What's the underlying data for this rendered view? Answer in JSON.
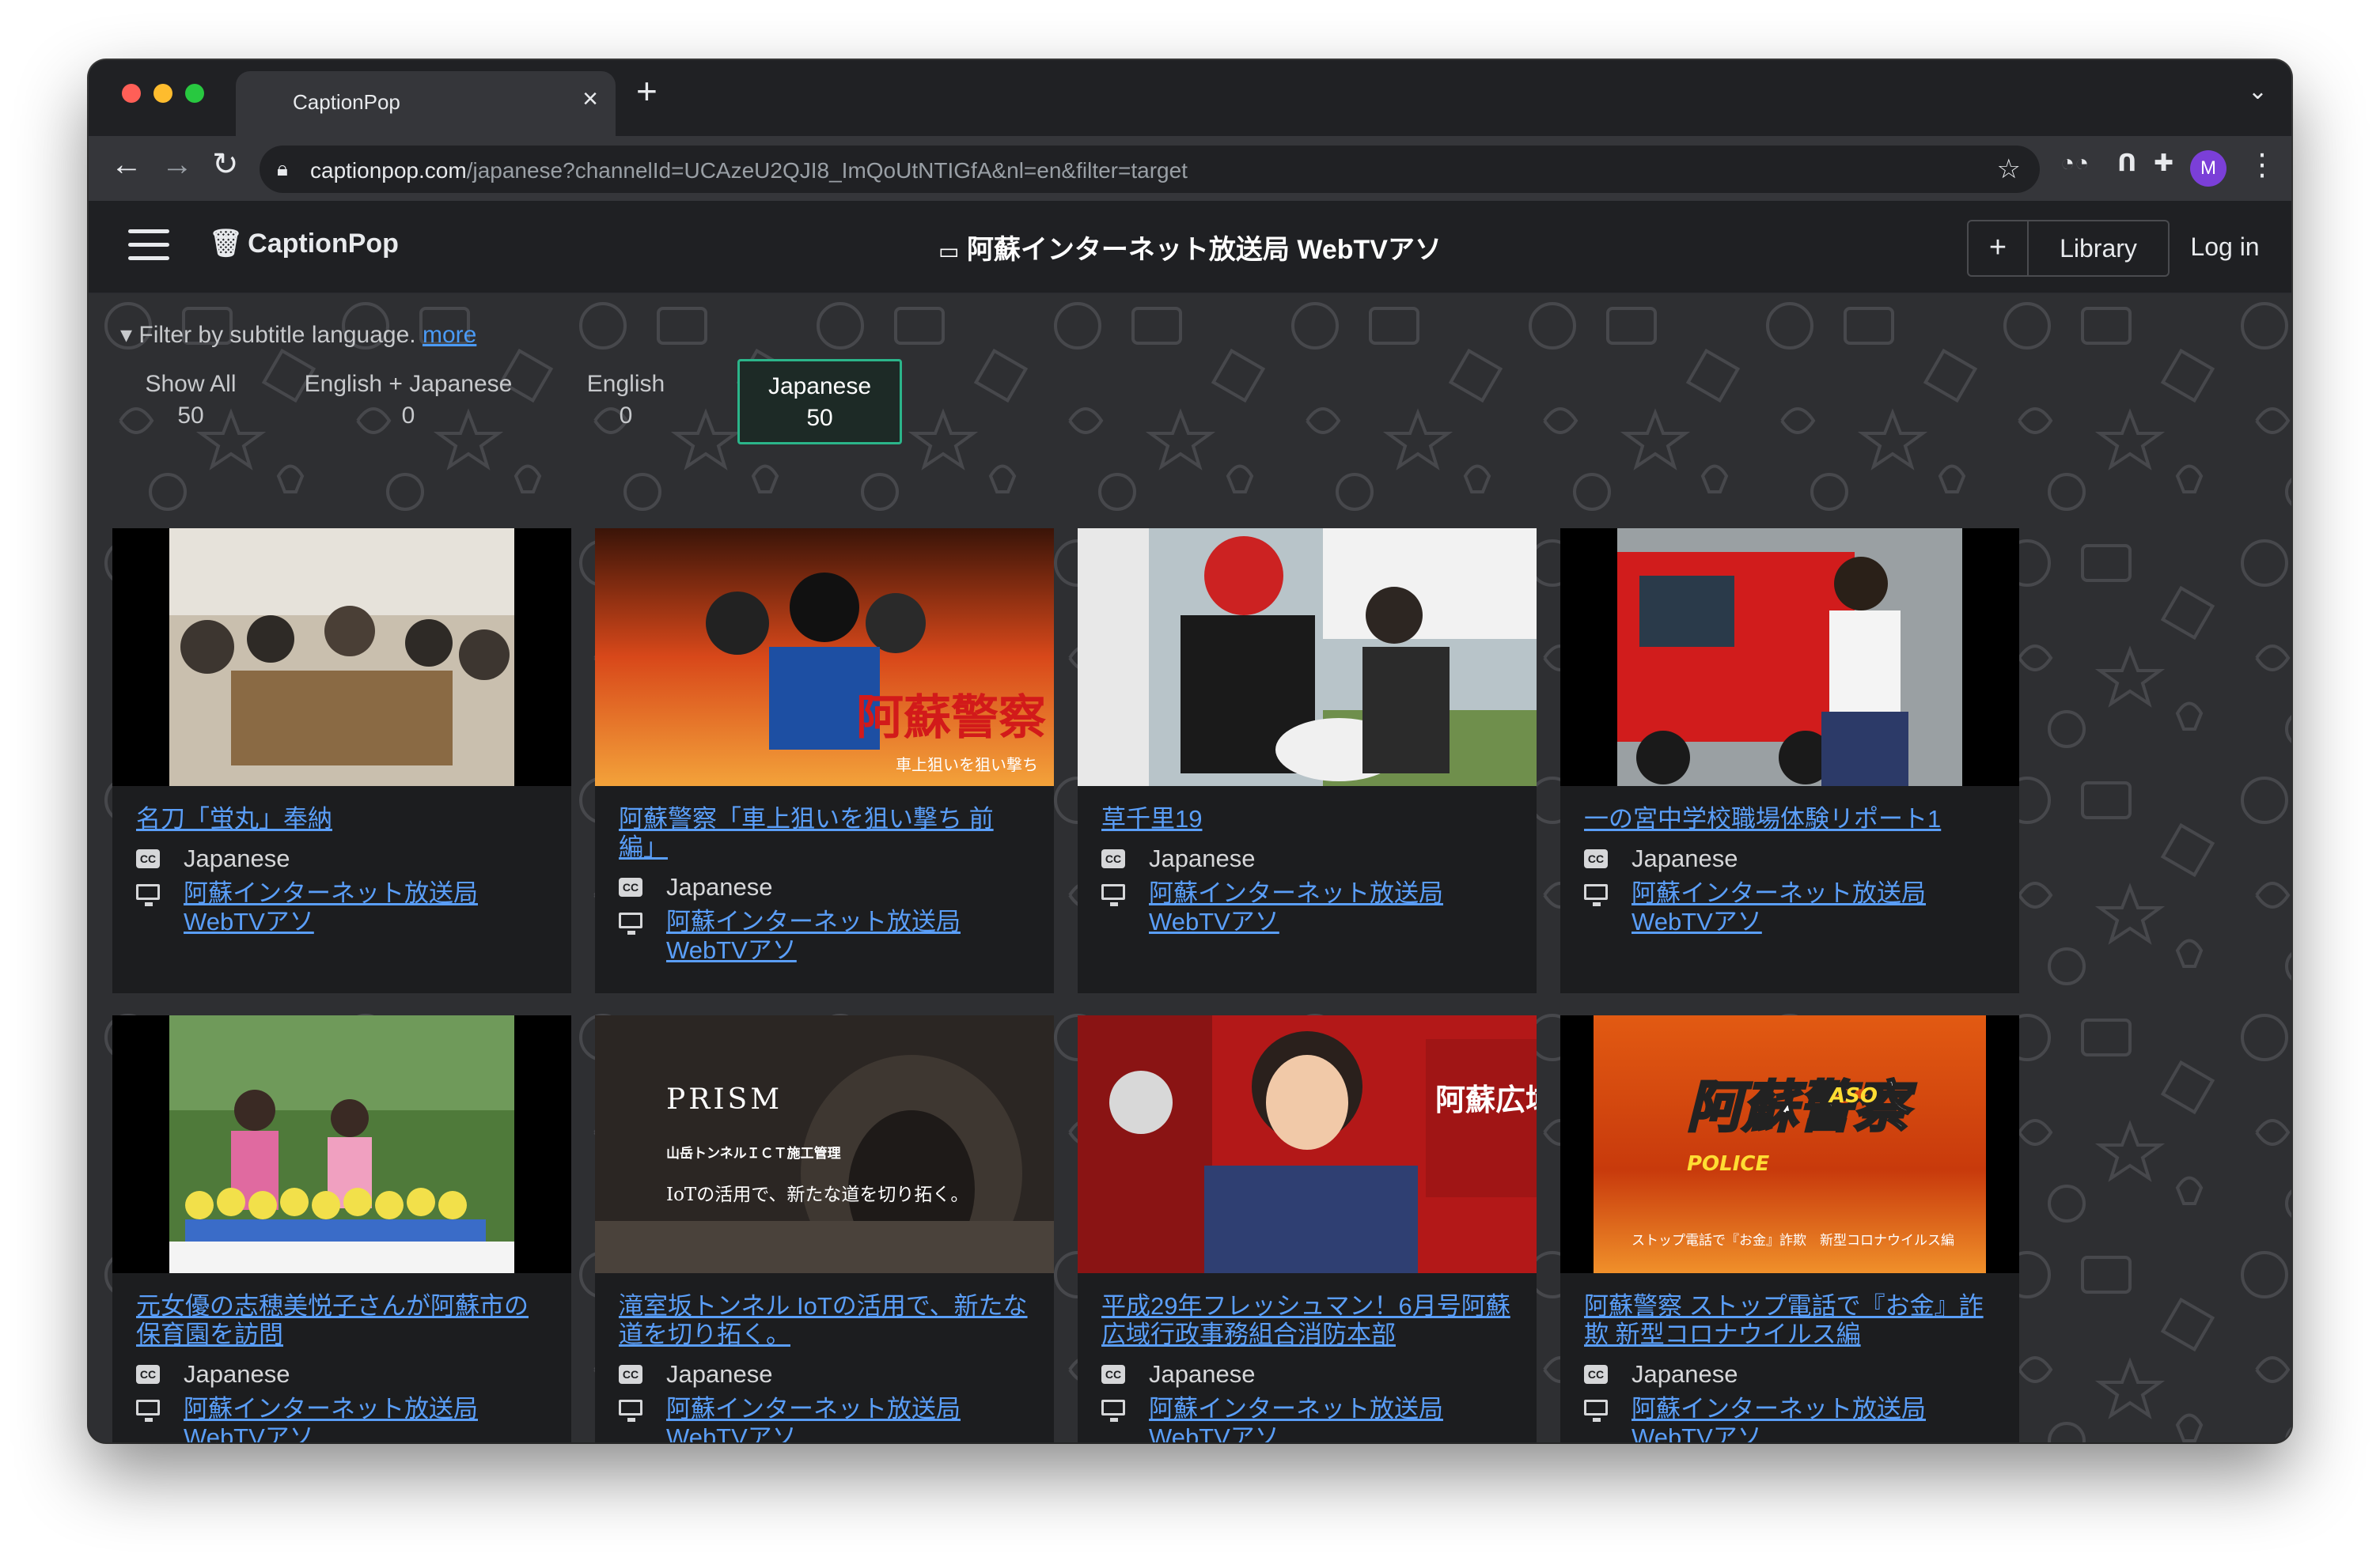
{
  "browser": {
    "tab_title": "CaptionPop",
    "url_host": "captionpop.com",
    "url_path": "/japanese?channelId=UCAzeU2QJI8_ImQoUtNTIGfA&nl=en&filter=target",
    "profile_initial": "M"
  },
  "app": {
    "brand": "CaptionPop",
    "channel_title": "阿蘇インターネット放送局 WebTVアソ",
    "add_label": "+",
    "library_label": "Library",
    "login_label": "Log in"
  },
  "filter": {
    "label": "Filter by subtitle language.",
    "more": "more",
    "tabs": [
      {
        "label": "Show All",
        "count": "50"
      },
      {
        "label": "English + Japanese",
        "count": "0"
      },
      {
        "label": "English",
        "count": "0"
      },
      {
        "label": "Japanese",
        "count": "50"
      }
    ]
  },
  "videos": [
    {
      "title": "名刀「蛍丸」奉納",
      "language": "Japanese",
      "channel": "阿蘇インターネット放送局 WebTVアソ"
    },
    {
      "title": "阿蘇警察「車上狙いを狙い撃ち 前編」",
      "language": "Japanese",
      "channel": "阿蘇インターネット放送局 WebTVアソ"
    },
    {
      "title": "草千里19",
      "language": "Japanese",
      "channel": "阿蘇インターネット放送局 WebTVアソ"
    },
    {
      "title": "一の宮中学校職場体験リポート1",
      "language": "Japanese",
      "channel": "阿蘇インターネット放送局 WebTVアソ"
    },
    {
      "title": "元女優の志穂美悦子さんが阿蘇市の保育園を訪問",
      "language": "Japanese",
      "channel": "阿蘇インターネット放送局 WebTVアソ"
    },
    {
      "title": "滝室坂トンネル IoTの活用で、新たな道を切り拓く。",
      "language": "Japanese",
      "channel": "阿蘇インターネット放送局 WebTVアソ"
    },
    {
      "title": "平成29年フレッシュマン！6月号阿蘇広域行政事務組合消防本部",
      "language": "Japanese",
      "channel": "阿蘇インターネット放送局 WebTVアソ"
    },
    {
      "title": "阿蘇警察 ストップ電話で『お金』詐欺 新型コロナウイルス編",
      "language": "Japanese",
      "channel": "阿蘇インターネット放送局 WebTVアソ"
    }
  ],
  "thumb_text": {
    "v2_overlay": "阿蘇警察",
    "v2_sub": "車上狙いを狙い撃ち",
    "v6_brand": "PRISM",
    "v6_line1": "山岳トンネルＩＣＴ施工管理",
    "v6_line2": "IoTの活用で、新たな道を切り拓く。",
    "v7_sign": "阿蘇広域",
    "v8_title": "阿蘇警察",
    "v8_aso": "ASO",
    "v8_police": "POLICE",
    "v8_sub": "ストップ電話で『お金』詐欺　新型コロナウイルス編"
  }
}
